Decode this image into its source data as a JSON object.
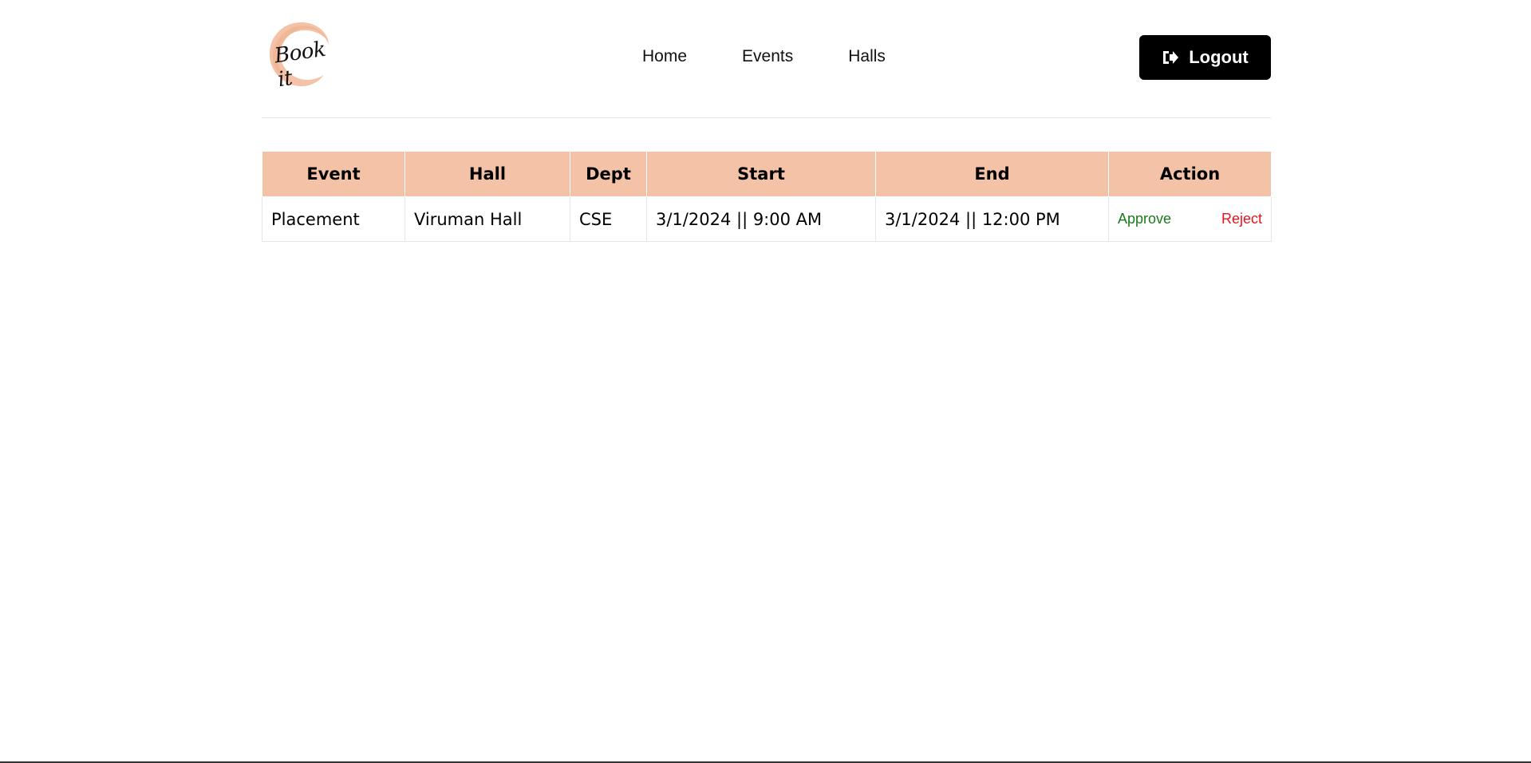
{
  "brand": {
    "logo_text": "Book it",
    "logo_color": "#f4c2a7"
  },
  "nav": {
    "items": [
      {
        "label": "Home"
      },
      {
        "label": "Events"
      },
      {
        "label": "Halls"
      }
    ]
  },
  "header": {
    "logout_label": "Logout",
    "logout_icon": "sign-out-icon"
  },
  "table": {
    "header_bg": "#f4c2a7",
    "columns": [
      "Event",
      "Hall",
      "Dept",
      "Start",
      "End",
      "Action"
    ],
    "rows": [
      {
        "event": "Placement",
        "hall": "Viruman Hall",
        "dept": "CSE",
        "start": "3/1/2024 || 9:00 AM",
        "end": "3/1/2024 || 12:00 PM",
        "approve_label": "Approve",
        "reject_label": "Reject"
      }
    ],
    "approve_color": "#1a7a1a",
    "reject_color": "#e8141d"
  }
}
